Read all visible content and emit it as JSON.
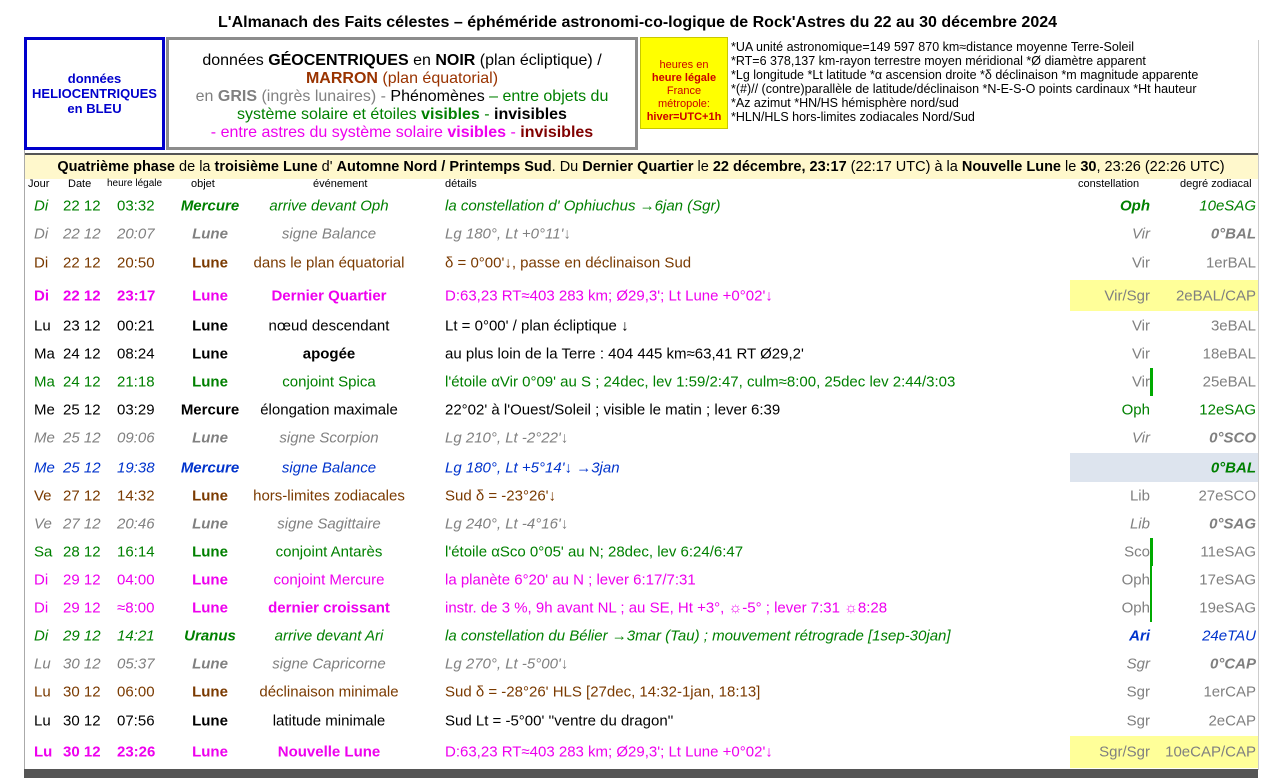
{
  "title": "L'Almanach des Faits célestes – éphéméride astronomi-co-logique de Rock'Astres du 22 au 30 décembre 2024",
  "helio_box": {
    "line1": "données",
    "line2": "HELIOCENTRIQUES",
    "line3": "en BLEU"
  },
  "geo_box": {
    "p1": "données ",
    "p2": "GÉOCENTRIQUES",
    "p3": " en ",
    "p4": "NOIR",
    "p5": " (plan écliptique)  /",
    "p6": "MARRON",
    "p7": " (plan équatorial)",
    "p8": "en ",
    "p9": "GRIS",
    "p10": " (ingrès lunaires)  -  ",
    "p11": "Phénomènes",
    "p12": " – entre objets du",
    "p13": "système solaire et étoiles ",
    "p14": "visibles",
    "p15": " - ",
    "p16": "invisibles",
    "p17": "- entre astres du système solaire ",
    "p18": "visibles",
    "p19": " - ",
    "p20": "invisibles"
  },
  "hours_box": {
    "l1": "heures en",
    "l2": "heure légale",
    "l3": "France",
    "l4": "métropole:",
    "l5": "hiver=UTC+1h"
  },
  "notes": [
    "*UA unité astronomique=149 597 870 km≈distance moyenne Terre-Soleil",
    "*RT=6 378,137 km-rayon terrestre moyen méridional   *Ø diamètre apparent",
    "*Lg longitude *Lt latitude  *α ascension droite *δ déclinaison  *m magnitude apparente",
    "*(#)// (contre)parallèle de latitude/déclinaison   *N-E-S-O points cardinaux  *Ht hauteur",
    "*Az azimut   *HN/HS hémisphère nord/sud",
    "*HLN/HLS hors-limites zodiacales Nord/Sud"
  ],
  "phase": {
    "a": "Quatrième phase",
    "b": " de la ",
    "c": "troisième Lune",
    "d": " d' ",
    "e": "Automne Nord / Printemps Sud",
    "f": ". Du ",
    "g": "Dernier Quartier",
    "h": " le ",
    "i": "22 décembre, 23:17",
    "j": " (22:17 UTC) à la ",
    "k": "Nouvelle Lune",
    "l": " le ",
    "m": "30",
    "n": ", 23:26 (22:26 UTC)"
  },
  "headers": {
    "jour": "Jour",
    "date": "Date",
    "heure": "heure légale",
    "objet": "objet",
    "evenement": "événement",
    "details": "détails",
    "constellation": "constellation",
    "degre": "degré zodiacal"
  },
  "rows": [
    {
      "jour": "Di",
      "date": "22 12",
      "heure": "03:32",
      "objet": "Mercure",
      "ev": "arrive devant Oph",
      "det": "la constellation d' Ophiuchus →6jan (Sgr)",
      "const": "Oph",
      "deg": "10eSAG"
    },
    {
      "jour": "Di",
      "date": "22 12",
      "heure": "20:07",
      "objet": "Lune",
      "ev": "signe Balance",
      "det": "Lg 180°, Lt +0°11'↓",
      "const": "Vir",
      "deg": "0°BAL"
    },
    {
      "jour": "Di",
      "date": "22 12",
      "heure": "20:50",
      "objet": "Lune",
      "ev": "dans le plan équatorial",
      "det": "δ = 0°00'↓, passe en déclinaison Sud",
      "const": "Vir",
      "deg": "1erBAL"
    },
    {
      "jour": "Di",
      "date": "22 12",
      "heure": "23:17",
      "objet": "Lune",
      "ev": "Dernier Quartier",
      "det": "D:63,23 RT≈403 283 km; Ø29,3'; Lt Lune +0°02'↓",
      "const": "Vir/Sgr",
      "deg": "2eBAL/CAP"
    },
    {
      "jour": "Lu",
      "date": "23 12",
      "heure": "00:21",
      "objet": "Lune",
      "ev": "nœud descendant",
      "det": "Lt = 0°00' / plan écliptique ↓",
      "const": "Vir",
      "deg": "3eBAL"
    },
    {
      "jour": "Ma",
      "date": "24 12",
      "heure": "08:24",
      "objet": "Lune",
      "ev": "apogée",
      "det": "au plus loin de la Terre : 404 445 km≈63,41 RT Ø29,2'",
      "const": "Vir",
      "deg": "18eBAL"
    },
    {
      "jour": "Ma",
      "date": "24 12",
      "heure": "21:18",
      "objet": "Lune",
      "ev": "conjoint Spica",
      "det": "l'étoile αVir 0°09' au S ; 24dec, lev 1:59/2:47, culm≈8:00, 25dec lev 2:44/3:03",
      "const": "Vir",
      "deg": "25eBAL"
    },
    {
      "jour": "Me",
      "date": "25 12",
      "heure": "03:29",
      "objet": "Mercure",
      "ev": "élongation maximale",
      "det": "22°02' à l'Ouest/Soleil ; visible le matin ; lever 6:39",
      "const": "Oph",
      "deg": "12eSAG"
    },
    {
      "jour": "Me",
      "date": "25 12",
      "heure": "09:06",
      "objet": "Lune",
      "ev": "signe Scorpion",
      "det": "Lg 210°, Lt -2°22'↓",
      "const": "Vir",
      "deg": "0°SCO"
    },
    {
      "jour": "Me",
      "date": "25 12",
      "heure": "19:38",
      "objet": "Mercure",
      "ev": "signe Balance",
      "det": "Lg 180°, Lt +5°14'↓ →3jan",
      "const": "",
      "deg": "0°BAL"
    },
    {
      "jour": "Ve",
      "date": "27 12",
      "heure": "14:32",
      "objet": "Lune",
      "ev": "hors-limites zodiacales",
      "det": "Sud δ = -23°26'↓",
      "const": "Lib",
      "deg": "27eSCO"
    },
    {
      "jour": "Ve",
      "date": "27 12",
      "heure": "20:46",
      "objet": "Lune",
      "ev": "signe Sagittaire",
      "det": "Lg 240°, Lt -4°16'↓",
      "const": "Lib",
      "deg": "0°SAG"
    },
    {
      "jour": "Sa",
      "date": "28 12",
      "heure": "16:14",
      "objet": "Lune",
      "ev": "conjoint Antarès",
      "det": "l'étoile αSco 0°05' au N; 28dec, lev 6:24/6:47",
      "const": "Sco",
      "deg": "11eSAG"
    },
    {
      "jour": "Di",
      "date": "29 12",
      "heure": "04:00",
      "objet": "Lune",
      "ev": "conjoint Mercure",
      "det": "la planète 6°20' au N ; lever 6:17/7:31",
      "const": "Oph",
      "deg": "17eSAG"
    },
    {
      "jour": "Di",
      "date": "29 12",
      "heure": "≈8:00",
      "objet": "Lune",
      "ev": "dernier croissant",
      "det": "instr. de 3 %, 9h avant NL ; au SE, Ht +3°, ☼-5° ; lever 7:31 ☼8:28",
      "const": "Oph",
      "deg": "19eSAG"
    },
    {
      "jour": "Di",
      "date": "29 12",
      "heure": "14:21",
      "objet": "Uranus",
      "ev": "arrive devant Ari",
      "det": "la constellation du Bélier →3mar (Tau) ; mouvement rétrograde [1sep-30jan]",
      "const": "Ari",
      "deg": "24eTAU"
    },
    {
      "jour": "Lu",
      "date": "30 12",
      "heure": "05:37",
      "objet": "Lune",
      "ev": "signe Capricorne",
      "det": "Lg 270°, Lt -5°00'↓",
      "const": "Sgr",
      "deg": "0°CAP"
    },
    {
      "jour": "Lu",
      "date": "30 12",
      "heure": "06:00",
      "objet": "Lune",
      "ev": "déclinaison minimale",
      "det": "Sud δ = -28°26' HLS [27dec, 14:32-1jan, 18:13]",
      "const": "Sgr",
      "deg": "1erCAP"
    },
    {
      "jour": "Lu",
      "date": "30 12",
      "heure": "07:56",
      "objet": "Lune",
      "ev": "latitude minimale",
      "det": "Sud Lt = -5°00' ''ventre du dragon''",
      "const": "Sgr",
      "deg": "2eCAP"
    },
    {
      "jour": "Lu",
      "date": "30 12",
      "heure": "23:26",
      "objet": "Lune",
      "ev": "Nouvelle Lune",
      "det": "D:63,23 RT≈403 283 km; Ø29,3'; Lt Lune +0°02'↓",
      "const": "Sgr/Sgr",
      "deg": "10eCAP/CAP"
    }
  ]
}
